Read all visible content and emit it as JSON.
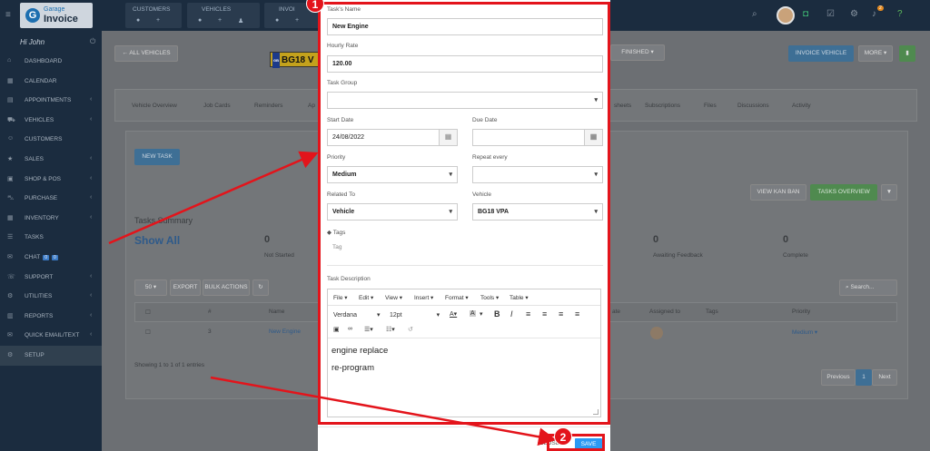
{
  "app": {
    "logo_small": "Garage",
    "logo_big": "Invoice",
    "greeting": "Hi John"
  },
  "topbar": {
    "quick_links": [
      {
        "label": "CUSTOMERS",
        "icons": [
          "●",
          "+"
        ]
      },
      {
        "label": "VEHICLES",
        "icons": [
          "●",
          "+",
          "♟"
        ]
      },
      {
        "label": "INVOI",
        "icons": [
          "●",
          "+",
          "▣"
        ]
      }
    ],
    "notification_count": "2"
  },
  "sidebar": {
    "items": [
      {
        "icon": "⌂",
        "label": "DASHBOARD",
        "chev": ""
      },
      {
        "icon": "▦",
        "label": "CALENDAR",
        "chev": ""
      },
      {
        "icon": "▤",
        "label": "APPOINTMENTS",
        "chev": "‹"
      },
      {
        "icon": "⛟",
        "label": "VEHICLES",
        "chev": "‹"
      },
      {
        "icon": "☺",
        "label": "CUSTOMERS",
        "chev": ""
      },
      {
        "icon": "★",
        "label": "SALES",
        "chev": "‹"
      },
      {
        "icon": "▣",
        "label": "SHOP & POS",
        "chev": "‹"
      },
      {
        "icon": "⛍",
        "label": "PURCHASE",
        "chev": "‹"
      },
      {
        "icon": "▦",
        "label": "INVENTORY",
        "chev": "‹"
      },
      {
        "icon": "☰",
        "label": "TASKS",
        "chev": ""
      },
      {
        "icon": "✉",
        "label": "CHAT",
        "chev": "",
        "badges": [
          "0",
          "0"
        ]
      },
      {
        "icon": "☏",
        "label": "SUPPORT",
        "chev": "‹"
      },
      {
        "icon": "⚙",
        "label": "UTILITIES",
        "chev": "‹"
      },
      {
        "icon": "▥",
        "label": "REPORTS",
        "chev": "‹"
      },
      {
        "icon": "✉",
        "label": "QUICK EMAIL/TEXT",
        "chev": "‹"
      },
      {
        "icon": "⚙",
        "label": "SETUP",
        "chev": ""
      }
    ]
  },
  "page": {
    "back_label": "← ALL VEHICLES",
    "plate": "BG18 V",
    "plate_country": "GB",
    "finished_label": "FINISHED ▾",
    "invoice_vehicle": "INVOICE VEHICLE",
    "more": "MORE ▾",
    "tabs_left": [
      "Vehicle Overview",
      "Job Cards",
      "Reminders",
      "Ap"
    ],
    "tabs_right": [
      "sheets",
      "Subscriptions",
      "Files",
      "Discussions",
      "Activity"
    ],
    "new_task": "NEW TASK",
    "view_kanban": "VIEW KAN BAN",
    "tasks_overview": "TASKS OVERVIEW",
    "tasks_summary": "Tasks Summary",
    "show_all": "Show All",
    "summary": [
      {
        "count": "0",
        "label": "Not Started"
      },
      {
        "count": "0",
        "label": "Awaiting Feedback"
      },
      {
        "count": "0",
        "label": "Complete"
      }
    ],
    "per_page": "50",
    "export": "EXPORT",
    "bulk_actions": "BULK ACTIONS",
    "search_placeholder": "Search...",
    "table_headers": [
      "#",
      "Name",
      "ate",
      "Assigned to",
      "Tags",
      "Priority"
    ],
    "row": {
      "id": "3",
      "name": "New Engine",
      "priority": "Medium ▾"
    },
    "showing": "Showing 1 to 1 of 1 entries",
    "previous": "Previous",
    "page_num": "1",
    "next": "Next"
  },
  "modal": {
    "task_name_label": "Task's Name",
    "task_name": "New Engine",
    "hourly_rate_label": "Hourly Rate",
    "hourly_rate": "120.00",
    "task_group_label": "Task Group",
    "task_group": "",
    "start_date_label": "Start Date",
    "start_date": "24/08/2022",
    "due_date_label": "Due Date",
    "due_date": "",
    "priority_label": "Priority",
    "priority": "Medium",
    "repeat_label": "Repeat every",
    "repeat": "",
    "related_label": "Related To",
    "related": "Vehicle",
    "vehicle_label": "Vehicle",
    "vehicle": "BG18 VPA",
    "tags_label": "Tags",
    "tag_placeholder": "Tag",
    "description_label": "Task Description",
    "menus": [
      "File ▾",
      "Edit ▾",
      "View ▾",
      "Insert ▾",
      "Format ▾",
      "Tools ▾",
      "Table ▾"
    ],
    "font": "Verdana",
    "font_size": "12pt",
    "lines": [
      "engine replace",
      "re-program"
    ],
    "close": "CLOSE",
    "save": "SAVE"
  },
  "annotations": {
    "marker1": "1",
    "marker2": "2",
    "color": "#e3141b"
  }
}
